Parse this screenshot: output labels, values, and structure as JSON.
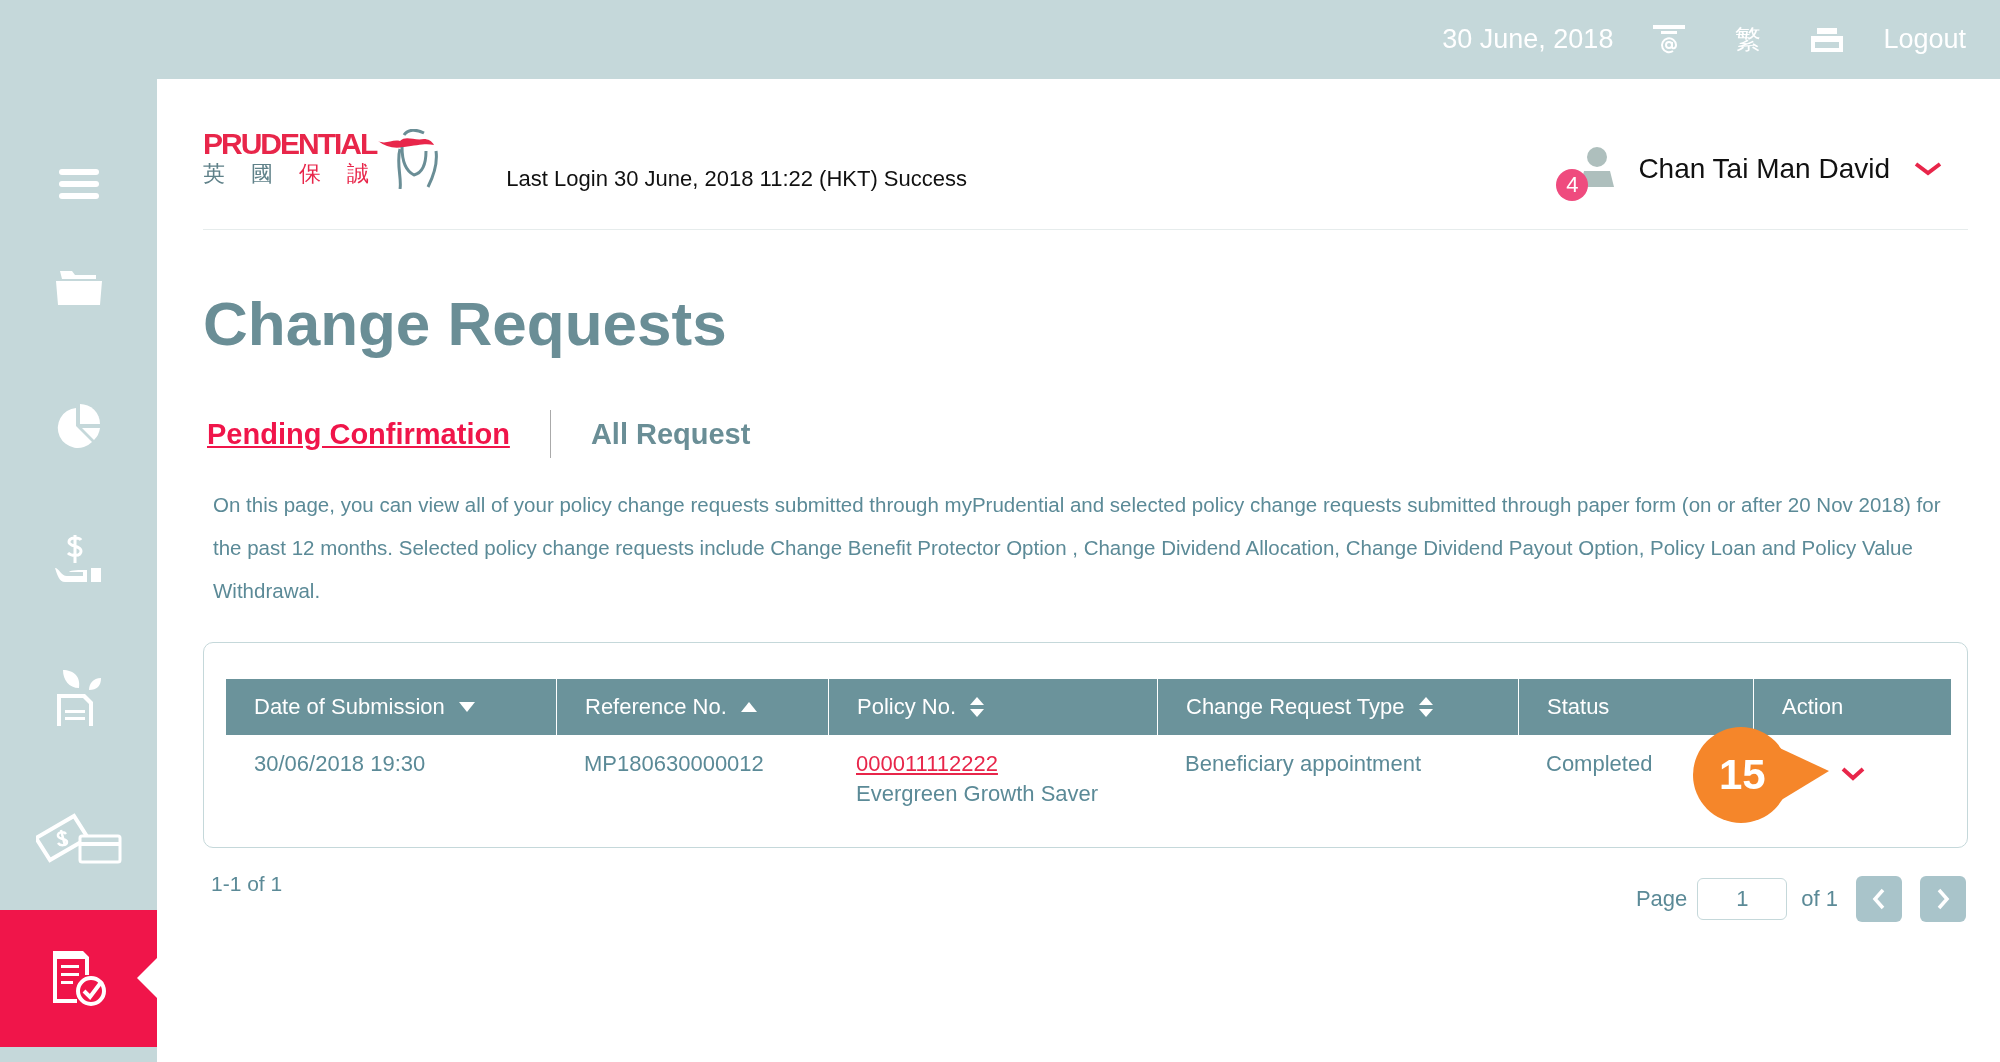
{
  "top_bar": {
    "date": "30 June, 2018",
    "language": "繁",
    "logout": "Logout"
  },
  "sidebar": {
    "items": [
      {
        "kind": "menu",
        "selected": false
      },
      {
        "kind": "folder",
        "selected": false
      },
      {
        "kind": "chart",
        "selected": false
      },
      {
        "kind": "money",
        "selected": false
      },
      {
        "kind": "plant",
        "selected": false
      },
      {
        "kind": "payment",
        "selected": false
      },
      {
        "kind": "request",
        "selected": true
      }
    ]
  },
  "header": {
    "logo": {
      "name": "PRUDENTIAL",
      "chinese": [
        "英",
        "國",
        "保",
        "誠"
      ]
    },
    "last_login": "Last Login 30 June, 2018 11:22 (HKT) Success",
    "user": {
      "name": "Chan Tai Man David",
      "badge": "4"
    }
  },
  "page_title": "Change Requests",
  "tabs": [
    {
      "label": "Pending Confirmation",
      "selected": true
    },
    {
      "label": "All Request",
      "selected": false
    }
  ],
  "description": "On this page, you can view all of your policy change requests submitted through myPrudential and selected policy change requests submitted through paper form (on or after 20 Nov 2018) for the past 12 months. Selected policy change requests include Change Benefit Protector Option , Change Dividend Allocation, Change Dividend Payout Option, Policy Loan and Policy Value Withdrawal.",
  "table": {
    "columns": [
      {
        "label": "Date of Submission",
        "sortable": true,
        "sorted": true,
        "ascending": false
      },
      {
        "label": "Reference No.",
        "sortable": true,
        "sorted": true,
        "ascending": true
      },
      {
        "label": "Policy No.",
        "sortable": true,
        "sorted": false
      },
      {
        "label": "Change Request Type",
        "sortable": true,
        "sorted": false
      },
      {
        "label": "Status",
        "sortable": false
      },
      {
        "label": "Action",
        "sortable": false
      }
    ],
    "rows": [
      {
        "date": "30/06/2018 19:30",
        "reference": "MP180630000012",
        "policy_no": "000011112222",
        "policy_name": "Evergreen Growth Saver",
        "type": "Beneficiary appointment",
        "status": "Completed",
        "callout": "15",
        "expanded": false
      }
    ]
  },
  "range": "1-1 of 1",
  "pagination": {
    "label": "Page",
    "value": "1",
    "total": "of 1"
  }
}
